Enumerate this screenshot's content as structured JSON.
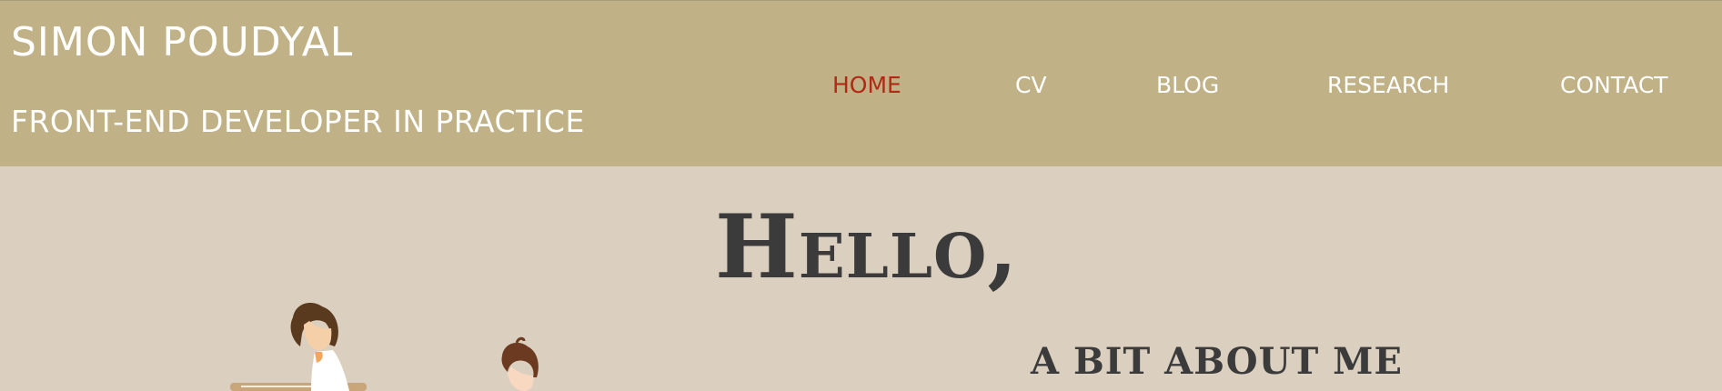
{
  "header": {
    "site_title": "SIMON POUDYAL",
    "tagline": "FRONT-END DEVELOPER IN PRACTICE"
  },
  "nav": {
    "items": [
      {
        "label": "HOME",
        "active": true
      },
      {
        "label": "CV",
        "active": false
      },
      {
        "label": "BLOG",
        "active": false
      },
      {
        "label": "RESEARCH",
        "active": false
      },
      {
        "label": "CONTACT",
        "active": false
      }
    ]
  },
  "main": {
    "greeting": "Hello,",
    "about_heading": "A BIT ABOUT ME",
    "illustration_icon": "people-working-illustration"
  },
  "colors": {
    "header_bg": "#c0b286",
    "page_bg": "#dbcfbf",
    "nav_active": "#b02a14",
    "nav_text": "#ffffff",
    "heading_text": "#3b3b3b"
  }
}
